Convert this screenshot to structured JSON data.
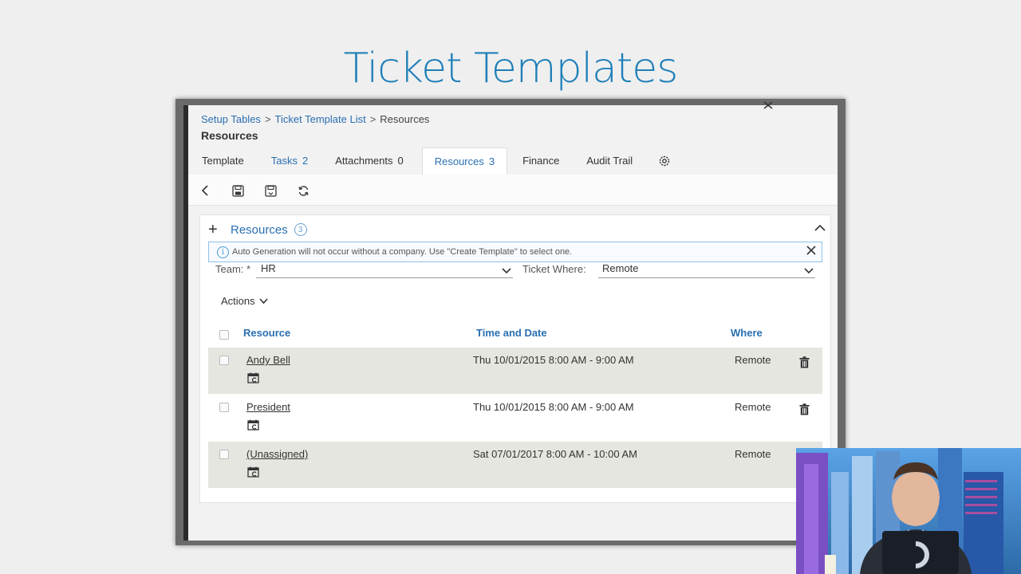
{
  "slide": {
    "title": "Ticket Templates"
  },
  "breadcrumb": {
    "items": [
      "Setup Tables",
      "Ticket Template List"
    ],
    "current": "Resources"
  },
  "page": {
    "title": "Resources"
  },
  "tabs": [
    {
      "label": "Template",
      "count": ""
    },
    {
      "label": "Tasks",
      "count": "2"
    },
    {
      "label": "Attachments",
      "count": "0"
    },
    {
      "label": "Resources",
      "count": "3"
    },
    {
      "label": "Finance",
      "count": ""
    },
    {
      "label": "Audit Trail",
      "count": ""
    }
  ],
  "panel": {
    "title": "Resources",
    "count": "3",
    "info": "Auto Generation will not occur without a company. Use \"Create Template\" to select one."
  },
  "filters": {
    "team_label": "Team: *",
    "team_value": "HR",
    "where_label": "Ticket Where:",
    "where_value": "Remote"
  },
  "actions_label": "Actions",
  "table": {
    "headers": [
      "Resource",
      "Time and Date",
      "Where"
    ],
    "rows": [
      {
        "resource": "Andy Bell",
        "time": "Thu 10/01/2015 8:00 AM - 9:00 AM",
        "where": "Remote"
      },
      {
        "resource": "President",
        "time": "Thu 10/01/2015 8:00 AM - 9:00 AM",
        "where": "Remote"
      },
      {
        "resource": "(Unassigned)",
        "time": "Sat 07/01/2017 8:00 AM - 10:00 AM",
        "where": "Remote"
      }
    ]
  },
  "colors": {
    "title_blue": "#1f7fb8",
    "link_blue": "#2a6fb0",
    "row_shade": "#e6e6e0"
  },
  "icons": [
    "back-arrow-icon",
    "save-icon",
    "save-as-icon",
    "refresh-icon",
    "gear-icon",
    "plus-icon",
    "chevron-up-icon",
    "info-icon",
    "close-icon",
    "chevron-down-icon",
    "calendar-icon",
    "trash-icon"
  ]
}
